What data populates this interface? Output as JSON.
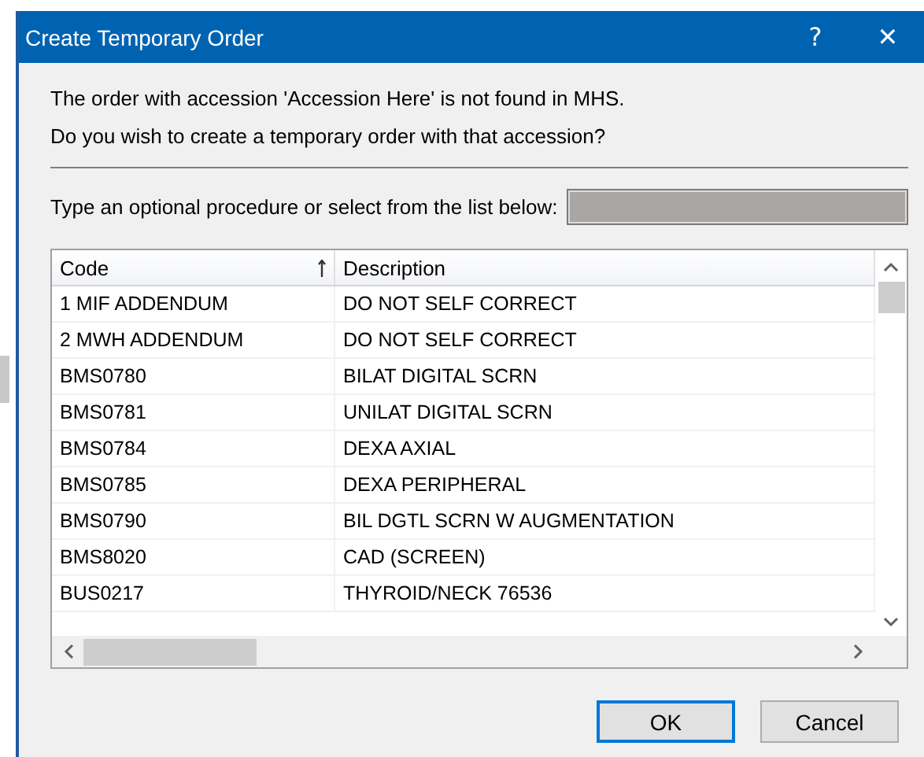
{
  "window": {
    "title": "Create Temporary Order",
    "help": "?",
    "close": "✕"
  },
  "message": [
    "The order with accession 'Accession Here' is not found in MHS.",
    "Do you wish to create a temporary order with that accession?"
  ],
  "procedure": {
    "label": "Type an optional procedure or select from the list below:",
    "disabled": true
  },
  "table": {
    "columns": [
      {
        "label": "Code",
        "sorted": true
      },
      {
        "label": "Description",
        "sorted": false
      }
    ],
    "rows": [
      {
        "code": "1 MIF ADDENDUM",
        "description": "DO NOT SELF CORRECT"
      },
      {
        "code": "2 MWH ADDENDUM",
        "description": "DO NOT SELF CORRECT"
      },
      {
        "code": "BMS0780",
        "description": "BILAT DIGITAL SCRN"
      },
      {
        "code": "BMS0781",
        "description": "UNILAT DIGITAL SCRN"
      },
      {
        "code": "BMS0784",
        "description": "DEXA AXIAL"
      },
      {
        "code": "BMS0785",
        "description": "DEXA PERIPHERAL"
      },
      {
        "code": "BMS0790",
        "description": "BIL DGTL SCRN W AUGMENTATION"
      },
      {
        "code": "BMS8020",
        "description": "CAD (SCREEN)"
      },
      {
        "code": "BUS0217",
        "description": "THYROID/NECK 76536"
      }
    ]
  },
  "buttons": [
    {
      "label": "OK",
      "default": true
    },
    {
      "label": "Cancel",
      "default": false
    }
  ]
}
